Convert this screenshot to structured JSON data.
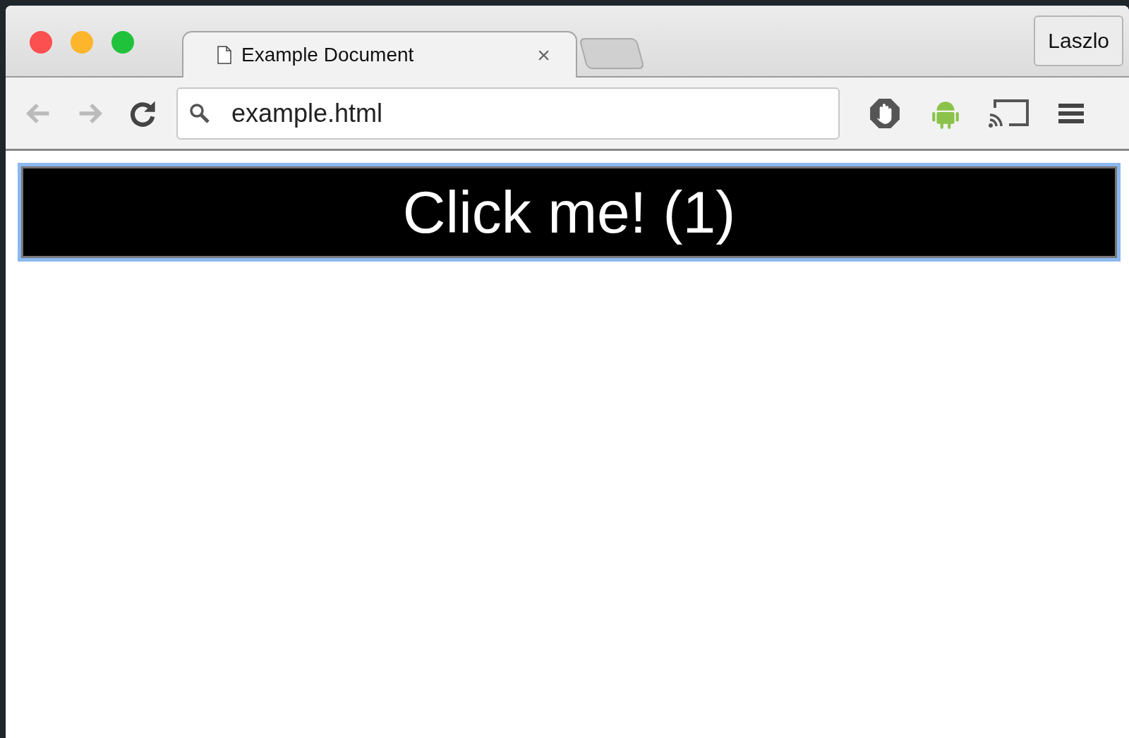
{
  "window": {
    "profile": "Laszlo"
  },
  "tabs": [
    {
      "label": "Example Document",
      "selected": true,
      "close": "×"
    }
  ],
  "toolbar": {
    "nav": [
      {
        "kind": "back",
        "disabled": true
      },
      {
        "kind": "forward",
        "disabled": true
      },
      {
        "kind": "reload",
        "disabled": false
      }
    ],
    "address": {
      "value": "example.html"
    }
  },
  "page": {
    "button": {
      "label": "Click me! (1)",
      "focused": true
    }
  }
}
